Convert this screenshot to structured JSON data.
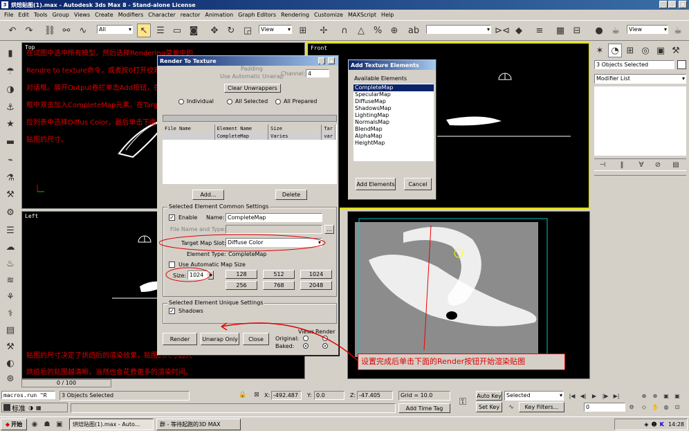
{
  "window": {
    "title": "烘焙贴图(1).max - Autodesk 3ds Max 8 - Stand-alone License"
  },
  "menu": [
    "File",
    "Edit",
    "Tools",
    "Group",
    "Views",
    "Create",
    "Modifiers",
    "Character",
    "reactor",
    "Animation",
    "Graph Editors",
    "Rendering",
    "Customize",
    "MAXScript",
    "Help"
  ],
  "toolbar": {
    "selection_filter": "All",
    "ref_coord": "View",
    "view_dropdown": "View"
  },
  "viewports": {
    "top": "Top",
    "front": "Front",
    "left": "Left"
  },
  "instructions": {
    "lines": [
      "在试图中选中所有模型，然后选择Rendering菜单中的",
      "Rendre to texture命令，或者按0打开纹理渲染设置",
      "对话框。展开Output卷拦单击Add按钮，在弹出的对话",
      "框中双击加入CompleteMap元素。在Target Map SLot下",
      "拉列表中选择Diffus Color，最后单击下面的1024设置",
      "贴图的尺寸。"
    ],
    "bottom": [
      "贴图的尺寸决定了烘焙后的渲染效果，贴图的尺寸越大",
      "烘焙后的贴图越清晰，当然也会花费更多的渲染时间。"
    ],
    "callout": "设置完成后单击下面的Render按钮开始渲染贴图"
  },
  "rtt": {
    "title": "Render To Texture",
    "padding_label": "Padding",
    "auto_unwrap": "Use Automatic Unwrap",
    "channel_label": "Channel:",
    "channel_value": "4",
    "clear_unwrappers": "Clear Unwrappers",
    "individual": "Individual",
    "all_selected": "All Selected",
    "all_prepared": "All Prepared",
    "columns": [
      "File Name",
      "Element Name",
      "Size",
      "Tar"
    ],
    "row": {
      "file": "",
      "element": "CompleteMap",
      "size": "Varies",
      "target": "var"
    },
    "add_btn": "Add...",
    "delete_btn": "Delete",
    "common_group": "Selected Element Common Settings",
    "enable": "Enable",
    "name_label": "Name:",
    "name_value": "CompleteMap",
    "file_type_label": "File Name and Type:",
    "target_slot_label": "Target Map Slot:",
    "target_slot_value": "Diffuse Color",
    "element_type_label": "Element Type:",
    "element_type_value": "CompleteMap",
    "use_auto_size": "Use Automatic Map Size",
    "size_label": "Size:",
    "size_value": "1024",
    "sizes": [
      "128",
      "512",
      "1024",
      "256",
      "768",
      "2048"
    ],
    "unique_group": "Selected Element Unique Settings",
    "shadows": "Shadows",
    "render_btn": "Render",
    "unwrap_btn": "Unwrap Only",
    "close_btn": "Close",
    "views": "Views",
    "render_col": "Render",
    "original": "Original:",
    "baked": "Baked:"
  },
  "ate": {
    "title": "Add Texture Elements",
    "available": "Available Elements",
    "items": [
      "CompleteMap",
      "SpecularMap",
      "DiffuseMap",
      "ShadowsMap",
      "LightingMap",
      "NormalsMap",
      "BlendMap",
      "AlphaMap",
      "HeightMap"
    ],
    "add": "Add Elements",
    "cancel": "Cancel"
  },
  "cmdpanel": {
    "selected": "3 Objects Selected",
    "modifier_list": "Modifier List"
  },
  "status": {
    "macro": "macros.run \"R",
    "objects": "3 Objects Selected",
    "x_label": "X:",
    "x": "-492.487",
    "y_label": "Y:",
    "y": "0.0",
    "z_label": "Z:",
    "z": "-47.405",
    "grid": "Grid = 10.0",
    "add_time_tag": "Add Time Tag",
    "auto_key": "Auto Key",
    "set_key": "Set Key",
    "key_mode": "Selected",
    "key_filters": "Key Filters...",
    "frame": "0",
    "time_slider": "0 / 100",
    "ime": "标准"
  },
  "taskbar": {
    "start": "开始",
    "task1": "烘焙贴图(1).max - Auto...",
    "task2": "群 - 等待起跑的3D MAX",
    "clock": "14:28"
  },
  "colors": {
    "instruction_red": "#e00000",
    "title_blue": "#0a246a",
    "active_border": "#e0e000"
  }
}
